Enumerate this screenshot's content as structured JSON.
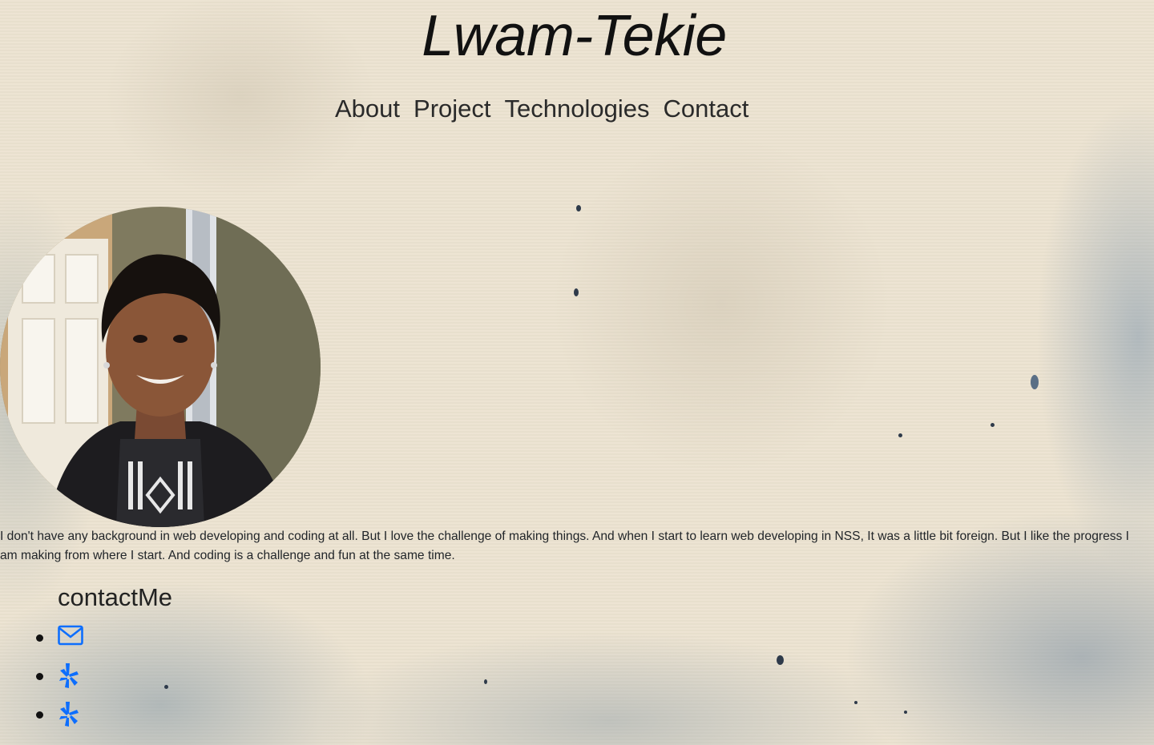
{
  "header": {
    "title": "Lwam-Tekie"
  },
  "nav": {
    "items": [
      {
        "label": "About"
      },
      {
        "label": "Project"
      },
      {
        "label": "Technologies"
      },
      {
        "label": "Contact"
      }
    ]
  },
  "about": {
    "text": "I don't have any background in web developing and coding at all. But I love the challenge of making things. And when I start to learn web developing in NSS, It was a little bit foreign. But I like the progress I am making from where I start. And coding is a challenge and fun at the same time."
  },
  "contact": {
    "heading": "contactMe",
    "links": [
      {
        "icon": "envelope-icon"
      },
      {
        "icon": "yelp-icon"
      },
      {
        "icon": "yelp-icon"
      }
    ]
  },
  "colors": {
    "background": "#ece3d1",
    "link_icon": "#0d6efd",
    "text": "#212529"
  }
}
